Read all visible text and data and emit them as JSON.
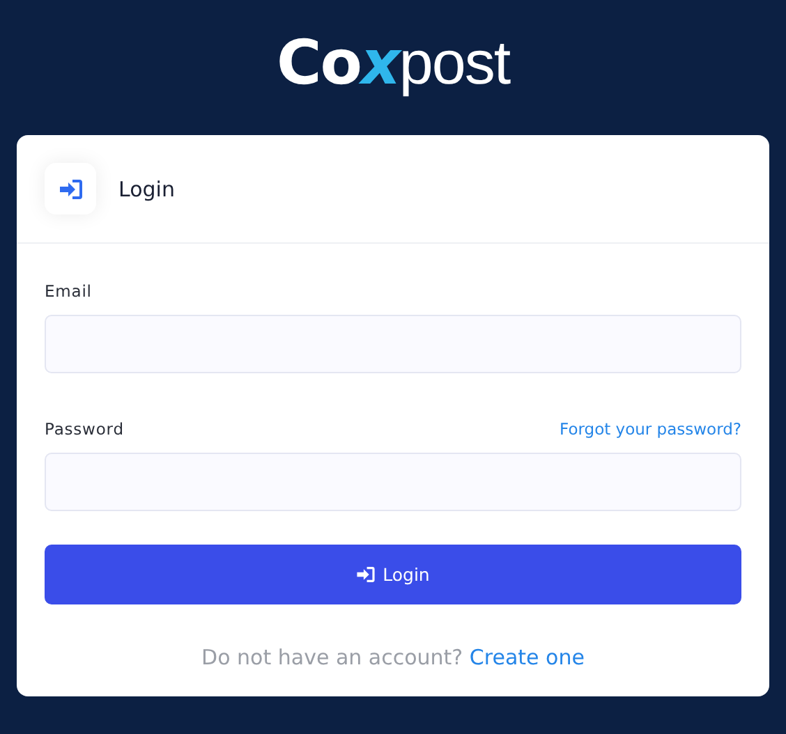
{
  "logo": {
    "first": "Co",
    "mark": "x",
    "rest": "post"
  },
  "card": {
    "title": "Login"
  },
  "fields": [
    {
      "label": "Email"
    },
    {
      "label": "Password",
      "link": "Forgot your password?"
    }
  ],
  "submit": {
    "label": "Login"
  },
  "footer": {
    "text": "Do not have an account?",
    "link": "Create one"
  }
}
